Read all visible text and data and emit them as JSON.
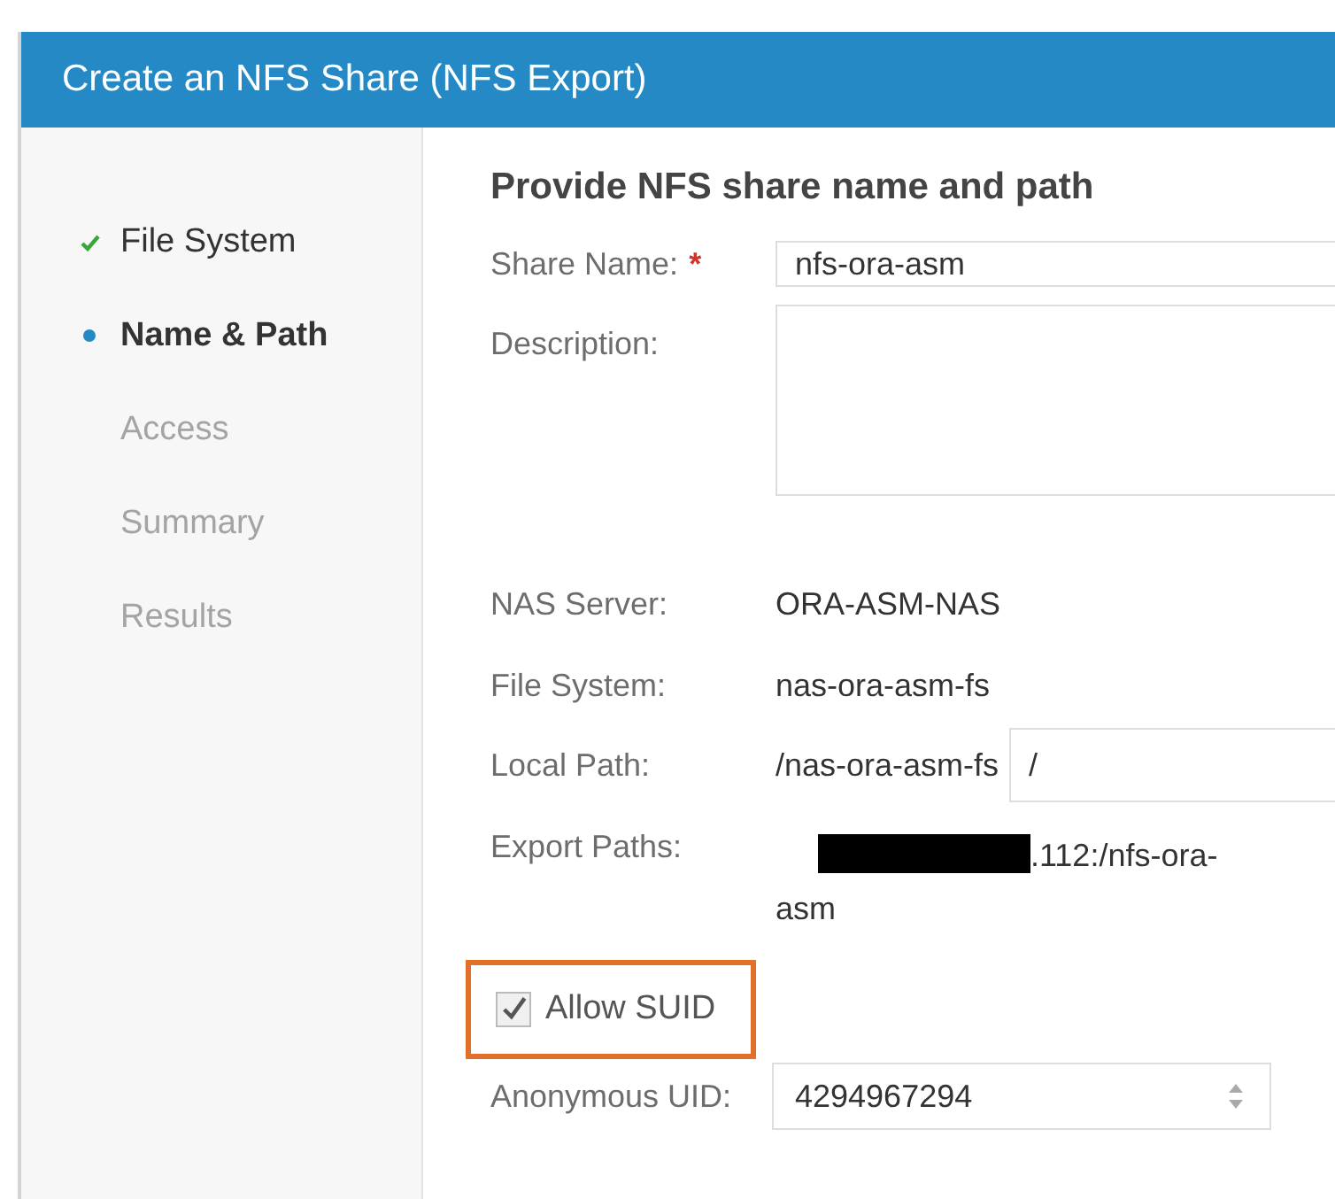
{
  "window": {
    "title": "Create an NFS Share (NFS Export)"
  },
  "steps": [
    {
      "label": "File System",
      "kind": "done"
    },
    {
      "label": "Name & Path",
      "kind": "current"
    },
    {
      "label": "Access",
      "kind": "pending"
    },
    {
      "label": "Summary",
      "kind": "pending"
    },
    {
      "label": "Results",
      "kind": "pending"
    }
  ],
  "heading": "Provide NFS share name and path",
  "share_name": {
    "label": "Share Name:",
    "required_mark": "*",
    "value": "nfs-ora-asm"
  },
  "description": {
    "label": "Description:"
  },
  "nas_server": {
    "label": "NAS Server:",
    "value": "ORA-ASM-NAS"
  },
  "file_system": {
    "label": "File System:",
    "value": "nas-ora-asm-fs"
  },
  "local_path": {
    "label": "Local Path:",
    "prefix": "/nas-ora-asm-fs",
    "value": "/"
  },
  "export_paths": {
    "label": "Export Paths:",
    "redacted": true,
    "value": ".112:/nfs-ora-asm"
  },
  "allow_suid": {
    "label": "Allow SUID",
    "checked": true,
    "highlighted": true
  },
  "anonymous_uid": {
    "label": "Anonymous UID:",
    "value": "4294967294"
  }
}
